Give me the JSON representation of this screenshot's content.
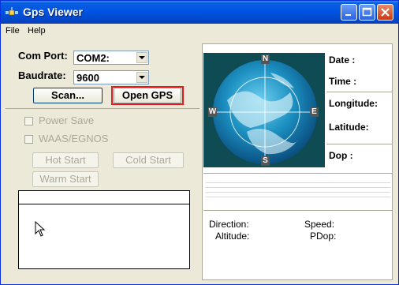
{
  "window": {
    "title": "Gps Viewer"
  },
  "menu": [
    "File",
    "Help"
  ],
  "settings": {
    "com_port_label": "Com Port:",
    "com_port_value": "COM2:",
    "baudrate_label": "Baudrate:",
    "baudrate_value": "9600"
  },
  "buttons": {
    "scan": "Scan...",
    "open_gps": "Open GPS",
    "hot_start": "Hot Start",
    "cold_start": "Cold Start",
    "warm_start": "Warm Start"
  },
  "checkboxes": {
    "power_save": "Power Save",
    "waas": "WAAS/EGNOS"
  },
  "compass": {
    "n": "N",
    "s": "S",
    "e": "E",
    "w": "W"
  },
  "info": {
    "date": "Date :",
    "time": "Time :",
    "longitude": "Longitude:",
    "latitude": "Latitude:",
    "dop": "Dop :"
  },
  "bottom": {
    "direction": "Direction:",
    "speed": "Speed:",
    "altitude": "Altitude:",
    "pdop": "PDop:"
  },
  "colors": {
    "highlight": "#e51a1a",
    "titlebar": "#0054e3"
  }
}
